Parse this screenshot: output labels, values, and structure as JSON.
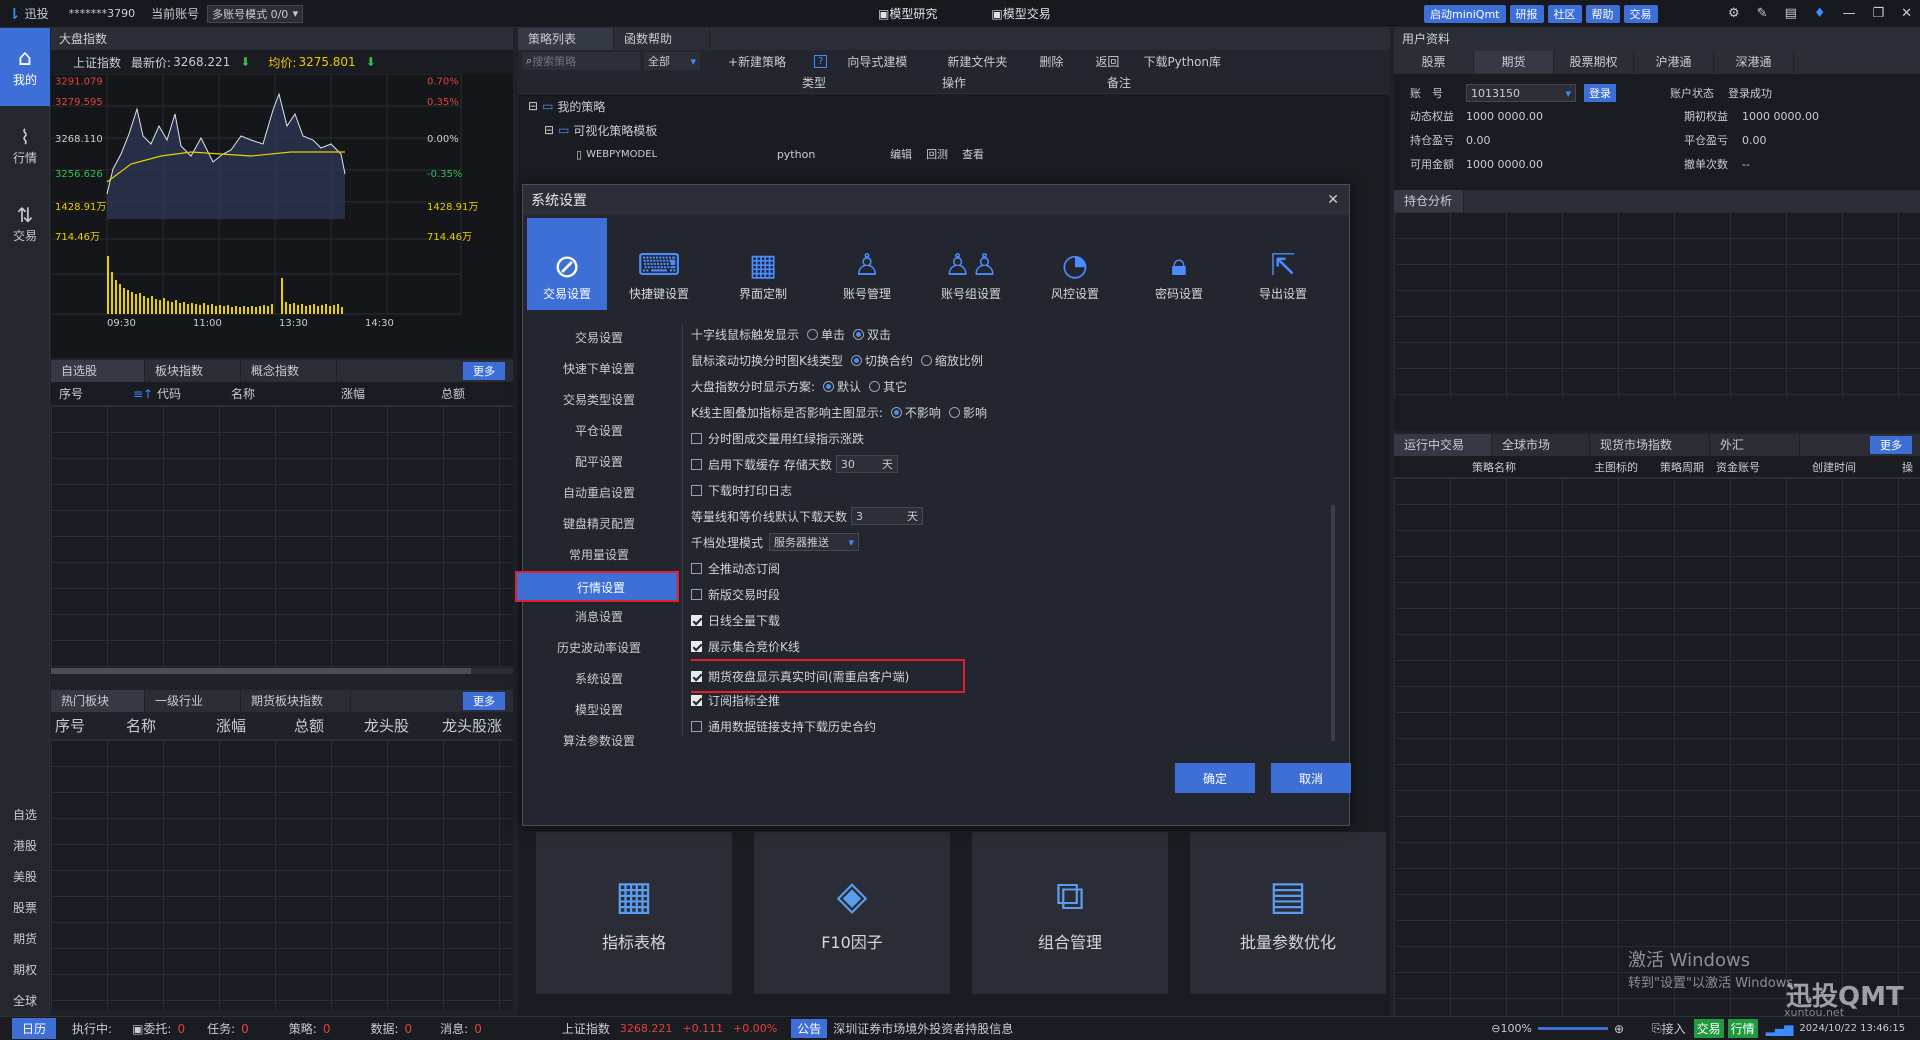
{
  "topbar": {
    "brand": "迅投",
    "account_mask": "*******3790",
    "current_account_label": "当前账号",
    "account_mode": "多账号模式 0/0",
    "center_tabs": [
      "模型研究",
      "模型交易"
    ],
    "right_buttons": [
      "启动miniQmt",
      "研报",
      "社区",
      "帮助",
      "交易"
    ]
  },
  "sidebar": {
    "top": [
      {
        "icon": "home-icon",
        "label": "我的"
      },
      {
        "icon": "chart-icon",
        "label": "行情"
      },
      {
        "icon": "trade-icon",
        "label": "交易"
      }
    ],
    "bottom": [
      "自选",
      "港股",
      "美股",
      "股票",
      "期货",
      "期权",
      "全球"
    ]
  },
  "index_panel": {
    "title": "大盘指数",
    "name": "上证指数",
    "latest_label": "最新价:",
    "latest": "3268.221",
    "avg_label": "均价:",
    "avg": "3275.801",
    "y_left": [
      "3291.079",
      "3279.595",
      "3268.110",
      "3256.626"
    ],
    "y_right": [
      "0.70%",
      "0.35%",
      "0.00%",
      "-0.35%"
    ],
    "vol_left": [
      "1428.91万",
      "714.46万"
    ],
    "vol_right": [
      "1428.91万",
      "714.46万"
    ],
    "x_ticks": [
      "09:30",
      "11:00",
      "13:30",
      "14:30"
    ]
  },
  "watch_tabs": {
    "tabs": [
      "自选股",
      "板块指数",
      "概念指数"
    ],
    "more": "更多",
    "cols": [
      "序号",
      "代码",
      "名称",
      "涨幅",
      "总额"
    ]
  },
  "sector_tabs": {
    "tabs": [
      "热门板块",
      "一级行业",
      "期货板块指数"
    ],
    "more": "更多",
    "cols": [
      "序号",
      "名称",
      "涨幅",
      "总额",
      "龙头股",
      "龙头股涨"
    ]
  },
  "strategy": {
    "tabs": [
      "策略列表",
      "函数帮助"
    ],
    "search_placeholder": "搜索策略",
    "filter": "全部",
    "actions": [
      "+新建策略",
      "?",
      "向导式建模",
      "新建文件夹",
      "删除",
      "返回",
      "下载Python库"
    ],
    "cols": [
      "类型",
      "操作",
      "备注"
    ],
    "tree": [
      {
        "label": "我的策略"
      },
      {
        "label": "可视化策略模板"
      },
      {
        "label": "WEBPYMODEL",
        "type": "python",
        "ops": [
          "编辑",
          "回测",
          "查看"
        ]
      }
    ]
  },
  "user_panel": {
    "title": "用户资料",
    "tabs": [
      "股票",
      "期货",
      "股票期权",
      "沪港通",
      "深港通"
    ],
    "account_label": "账　号",
    "account": "1013150",
    "login_btn": "登录",
    "status_label": "账户状态",
    "status": "登录成功",
    "fields": [
      [
        "动态权益",
        "1000 0000.00",
        "期初权益",
        "1000 0000.00"
      ],
      [
        "持仓盈亏",
        "0.00",
        "平仓盈亏",
        "0.00"
      ],
      [
        "可用金额",
        "1000 0000.00",
        "撤单次数",
        "--"
      ]
    ],
    "position_title": "持仓分析"
  },
  "run_panel": {
    "tabs": [
      "运行中交易",
      "全球市场",
      "现货市场指数",
      "外汇"
    ],
    "more": "更多",
    "cols": [
      "策略名称",
      "主图标的",
      "策略周期",
      "资金账号",
      "创建时间",
      "操"
    ]
  },
  "modal": {
    "title": "系统设置",
    "icon_tabs": [
      {
        "icon": "trade-settings-icon",
        "label": "交易设置"
      },
      {
        "icon": "keyboard-icon",
        "label": "快捷键设置"
      },
      {
        "icon": "layout-icon",
        "label": "界面定制"
      },
      {
        "icon": "user-icon",
        "label": "账号管理"
      },
      {
        "icon": "users-icon",
        "label": "账号组设置"
      },
      {
        "icon": "gauge-icon",
        "label": "风控设置"
      },
      {
        "icon": "lock-icon",
        "label": "密码设置"
      },
      {
        "icon": "export-icon",
        "label": "导出设置"
      }
    ],
    "menu": [
      "交易设置",
      "快速下单设置",
      "交易类型设置",
      "平仓设置",
      "配平设置",
      "自动重启设置",
      "键盘精灵配置",
      "常用量设置",
      "行情设置",
      "消息设置",
      "历史波动率设置",
      "系统设置",
      "模型设置",
      "算法参数设置"
    ],
    "options": {
      "crosshair": {
        "label": "十字线鼠标触发显示",
        "a": "单击",
        "b": "双击"
      },
      "scroll": {
        "label": "鼠标滚动切换分时图K线类型",
        "a": "切换合约",
        "b": "缩放比例"
      },
      "index_scheme": {
        "label": "大盘指数分时显示方案:",
        "a": "默认",
        "b": "其它"
      },
      "kline_overlay": {
        "label": "K线主图叠加指标是否影响主图显示:",
        "a": "不影响",
        "b": "影响"
      },
      "checks1": [
        "分时图成交量用红绿指示涨跌",
        "启用下载缓存 存储天数"
      ],
      "cache_days": "30",
      "day_unit": "天",
      "check_print": "下载时打印日志",
      "default_days_label": "等量线和等价线默认下载天数",
      "default_days": "3",
      "tick_mode_label": "千档处理模式",
      "tick_mode": "服务器推送",
      "checks2": [
        {
          "label": "全推动态订阅",
          "on": false
        },
        {
          "label": "新版交易时段",
          "on": false
        },
        {
          "label": "日线全量下载",
          "on": true
        },
        {
          "label": "展示集合竞价K线",
          "on": true
        },
        {
          "label": "期货夜盘显示真实时间(需重启客户端)",
          "on": true
        },
        {
          "label": "订阅指标全推",
          "on": true
        },
        {
          "label": "通用数据链接支持下载历史合约",
          "on": false
        }
      ]
    },
    "ok": "确定",
    "cancel": "取消"
  },
  "cards": [
    "指标表格",
    "F10因子",
    "组合管理",
    "批量参数优化"
  ],
  "watermark": {
    "line1": "激活 Windows",
    "line2": "转到\"设置\"以激活 Windows。",
    "brand": "迅投QMT",
    "url": "xuntou.net"
  },
  "bottombar": {
    "items": [
      "日历",
      "执行中:",
      "委托:",
      "0",
      "任务:",
      "0",
      "策略:",
      "0",
      "数据:",
      "0",
      "消息:",
      "0"
    ],
    "index_name": "上证指数",
    "index_val": "3268.221",
    "index_chg": "+0.111",
    "index_pct": "+0.00%",
    "notice_tag": "公告",
    "notice": "深圳证券市场境外投资者持股信息",
    "zoom": "100%",
    "import": "接入",
    "trade": "交易",
    "market": "行情",
    "datetime": "2024/10/22 13:46:15"
  }
}
